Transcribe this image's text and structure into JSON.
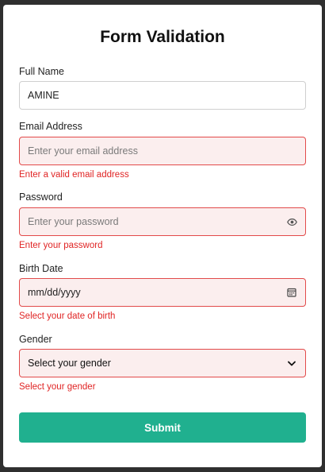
{
  "form": {
    "title": "Form Validation",
    "full_name": {
      "label": "Full Name",
      "value": "AMINE"
    },
    "email": {
      "label": "Email Address",
      "placeholder": "Enter your email address",
      "error": "Enter a valid email address"
    },
    "password": {
      "label": "Password",
      "placeholder": "Enter your password",
      "error": "Enter your password",
      "icon": "eye-icon"
    },
    "birth_date": {
      "label": "Birth Date",
      "placeholder": "mm/dd/yyyy",
      "error": "Select your date of birth",
      "icon": "calendar-icon"
    },
    "gender": {
      "label": "Gender",
      "selected": "Select your gender",
      "error": "Select your gender",
      "icon": "chevron-down-icon"
    },
    "submit_label": "Submit"
  },
  "colors": {
    "accent": "#20b08f",
    "error": "#e02424",
    "error_bg": "#fbeeee",
    "page_bg": "#2f2f2f"
  }
}
